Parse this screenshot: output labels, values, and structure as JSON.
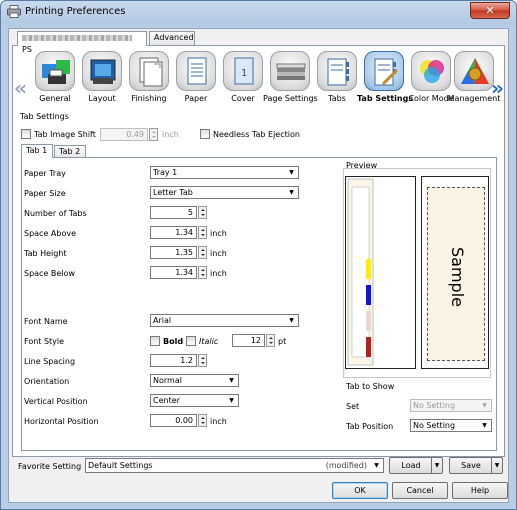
{
  "window": {
    "title": "Printing Preferences",
    "close_glyph": "✕"
  },
  "tabs": [
    {
      "label": "PS"
    },
    {
      "label": "Advanced"
    }
  ],
  "icon_strip": {
    "prev_glyph": "«",
    "next_glyph": "»",
    "items": [
      {
        "label": "General",
        "icon": "general-icon"
      },
      {
        "label": "Layout",
        "icon": "layout-icon"
      },
      {
        "label": "Finishing",
        "icon": "finishing-icon"
      },
      {
        "label": "Paper",
        "icon": "paper-icon"
      },
      {
        "label": "Cover",
        "icon": "cover-icon"
      },
      {
        "label": "Page Settings",
        "icon": "page-settings-icon"
      },
      {
        "label": "Tabs",
        "icon": "tabs-icon"
      },
      {
        "label": "Tab Settings",
        "icon": "tab-settings-icon",
        "selected": true
      },
      {
        "label": "Color Mode",
        "icon": "color-mode-icon"
      },
      {
        "label": "Management",
        "icon": "management-icon"
      }
    ]
  },
  "tab_settings": {
    "group_title": "Tab Settings",
    "tab_image_shift": {
      "label": "Tab Image Shift",
      "checked": false,
      "value": "0.49",
      "unit": "inch"
    },
    "needless_tab_ejection": {
      "label": "Needless Tab Ejection",
      "checked": false
    }
  },
  "subtabs": [
    {
      "label": "Tab 1"
    },
    {
      "label": "Tab 2"
    }
  ],
  "form": {
    "paper_tray": {
      "label": "Paper Tray",
      "value": "Tray 1"
    },
    "paper_size": {
      "label": "Paper Size",
      "value": "Letter Tab"
    },
    "number_of_tabs": {
      "label": "Number of Tabs",
      "value": "5"
    },
    "space_above": {
      "label": "Space Above",
      "value": "1.34",
      "unit": "inch"
    },
    "tab_height": {
      "label": "Tab Height",
      "value": "1.35",
      "unit": "inch"
    },
    "space_below": {
      "label": "Space Below",
      "value": "1.34",
      "unit": "inch"
    },
    "font_name": {
      "label": "Font Name",
      "value": "Arial"
    },
    "font_style": {
      "label": "Font Style",
      "bold": "Bold",
      "italic": "Italic",
      "size": "12",
      "unit": "pt"
    },
    "line_spacing": {
      "label": "Line Spacing",
      "value": "1.2"
    },
    "orientation": {
      "label": "Orientation",
      "value": "Normal"
    },
    "vertical_position": {
      "label": "Vertical Position",
      "value": "Center"
    },
    "horizontal_position": {
      "label": "Horizontal Position",
      "value": "0.00",
      "unit": "inch"
    }
  },
  "preview": {
    "title": "Preview",
    "sample_text": "Sample",
    "tab_colors": [
      "#ffee00",
      "#1010e0",
      "#e8d8d0",
      "#b02020"
    ],
    "tab_to_show": "Tab to Show",
    "set": {
      "label": "Set",
      "value": "No Setting"
    },
    "tab_position": {
      "label": "Tab Position",
      "value": "No Setting"
    }
  },
  "favorite": {
    "label": "Favorite Setting",
    "value": "Default Settings",
    "status": "(modified)",
    "load": "Load",
    "save": "Save"
  },
  "buttons": {
    "ok": "OK",
    "cancel": "Cancel",
    "help": "Help"
  },
  "colors": {
    "accent": "#3a6ea5",
    "titlebar": "#c9daee",
    "close": "#c0351f"
  }
}
